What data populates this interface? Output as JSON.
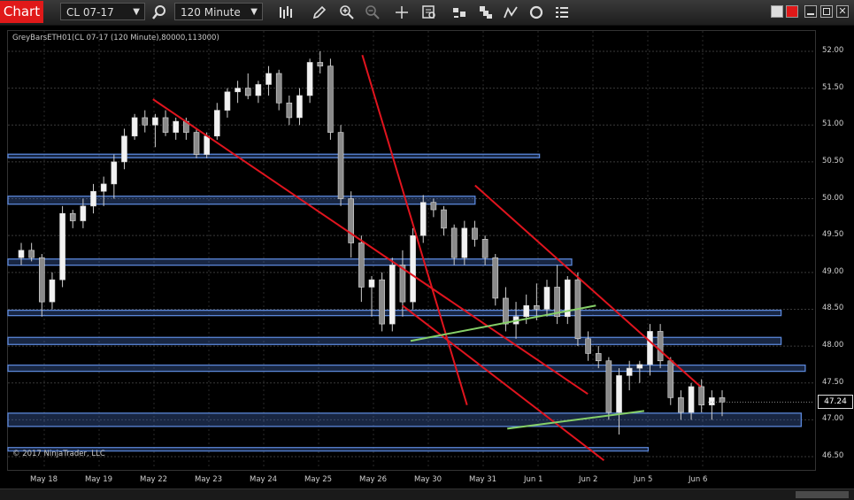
{
  "toolbar": {
    "chart_tab": "Chart",
    "instrument": "CL 07-17",
    "interval": "120 Minute",
    "icons": [
      "search-icon",
      "bars-icon",
      "pencil-icon",
      "zoom-in-icon",
      "zoom-out-icon",
      "crosshair-icon",
      "data-box-icon",
      "performance-icon",
      "strategy-icon",
      "drawing-tools-icon",
      "reload-icon",
      "properties-icon"
    ]
  },
  "window_controls": [
    "white-square",
    "red-square",
    "minimize",
    "maximize",
    "close"
  ],
  "chart": {
    "title": "GreyBarsETH01(CL 07-17 (120 Minute),80000,113000)",
    "copyright": "© 2017 NinjaTrader, LLC",
    "last_price": "47.24",
    "y_ticks": [
      "52.00",
      "51.50",
      "51.00",
      "50.50",
      "50.00",
      "49.50",
      "49.00",
      "48.50",
      "48.00",
      "47.50",
      "47.00",
      "46.50"
    ],
    "x_ticks": [
      "May 18",
      "May 19",
      "May 22",
      "May 23",
      "May 24",
      "May 25",
      "May 26",
      "May 30",
      "May 31",
      "Jun 1",
      "Jun 2",
      "Jun 5",
      "Jun 6"
    ]
  },
  "chart_data": {
    "type": "candlestick",
    "instrument": "CL 07-17",
    "interval": "120 Minute",
    "ylim": [
      46.4,
      52.05
    ],
    "ohlc": [
      [
        49.2,
        49.4,
        49.1,
        49.3
      ],
      [
        49.3,
        49.4,
        49.15,
        49.2
      ],
      [
        49.2,
        49.25,
        48.4,
        48.6
      ],
      [
        48.6,
        49.0,
        48.5,
        48.9
      ],
      [
        48.9,
        49.9,
        48.8,
        49.8
      ],
      [
        49.8,
        49.85,
        49.6,
        49.7
      ],
      [
        49.7,
        50.0,
        49.6,
        49.9
      ],
      [
        49.9,
        50.2,
        49.8,
        50.1
      ],
      [
        50.1,
        50.3,
        49.9,
        50.2
      ],
      [
        50.2,
        50.6,
        50.0,
        50.5
      ],
      [
        50.5,
        50.95,
        50.4,
        50.85
      ],
      [
        50.85,
        51.15,
        50.8,
        51.1
      ],
      [
        51.1,
        51.2,
        50.9,
        51.0
      ],
      [
        51.0,
        51.15,
        50.7,
        51.1
      ],
      [
        51.1,
        51.2,
        50.85,
        50.9
      ],
      [
        50.9,
        51.1,
        50.8,
        51.05
      ],
      [
        51.05,
        51.1,
        50.8,
        50.9
      ],
      [
        50.9,
        50.95,
        50.55,
        50.6
      ],
      [
        50.6,
        50.9,
        50.55,
        50.85
      ],
      [
        50.85,
        51.3,
        50.8,
        51.2
      ],
      [
        51.2,
        51.5,
        51.1,
        51.45
      ],
      [
        51.45,
        51.6,
        51.3,
        51.5
      ],
      [
        51.5,
        51.7,
        51.35,
        51.4
      ],
      [
        51.4,
        51.6,
        51.3,
        51.55
      ],
      [
        51.55,
        51.8,
        51.4,
        51.7
      ],
      [
        51.7,
        51.75,
        51.2,
        51.3
      ],
      [
        51.3,
        51.4,
        51.0,
        51.1
      ],
      [
        51.1,
        51.5,
        51.0,
        51.4
      ],
      [
        51.4,
        51.9,
        51.3,
        51.85
      ],
      [
        51.85,
        52.0,
        51.7,
        51.8
      ],
      [
        51.8,
        51.9,
        50.8,
        50.9
      ],
      [
        50.9,
        51.0,
        49.9,
        50.0
      ],
      [
        50.0,
        50.1,
        49.2,
        49.4
      ],
      [
        49.4,
        49.5,
        48.6,
        48.8
      ],
      [
        48.8,
        48.95,
        48.4,
        48.9
      ],
      [
        48.9,
        49.0,
        48.2,
        48.3
      ],
      [
        48.3,
        49.2,
        48.2,
        49.1
      ],
      [
        49.1,
        49.3,
        48.4,
        48.6
      ],
      [
        48.6,
        49.6,
        48.5,
        49.5
      ],
      [
        49.5,
        50.05,
        49.4,
        49.95
      ],
      [
        49.95,
        50.0,
        49.75,
        49.85
      ],
      [
        49.85,
        49.9,
        49.5,
        49.6
      ],
      [
        49.6,
        49.65,
        49.1,
        49.2
      ],
      [
        49.2,
        49.7,
        49.1,
        49.6
      ],
      [
        49.6,
        49.7,
        49.35,
        49.45
      ],
      [
        49.45,
        49.5,
        49.1,
        49.2
      ],
      [
        49.2,
        49.25,
        48.55,
        48.65
      ],
      [
        48.65,
        48.8,
        48.2,
        48.3
      ],
      [
        48.3,
        48.6,
        48.1,
        48.4
      ],
      [
        48.4,
        48.7,
        48.3,
        48.55
      ],
      [
        48.55,
        48.85,
        48.35,
        48.5
      ],
      [
        48.5,
        48.9,
        48.4,
        48.8
      ],
      [
        48.8,
        49.1,
        48.3,
        48.4
      ],
      [
        48.4,
        48.95,
        48.3,
        48.9
      ],
      [
        48.9,
        49.0,
        48.0,
        48.1
      ],
      [
        48.1,
        48.2,
        47.8,
        47.9
      ],
      [
        47.9,
        48.0,
        47.7,
        47.8
      ],
      [
        47.8,
        47.85,
        47.0,
        47.1
      ],
      [
        47.1,
        47.7,
        46.8,
        47.6
      ],
      [
        47.6,
        47.8,
        47.4,
        47.7
      ],
      [
        47.7,
        47.8,
        47.5,
        47.75
      ],
      [
        47.75,
        48.3,
        47.6,
        48.2
      ],
      [
        48.2,
        48.3,
        47.7,
        47.8
      ],
      [
        47.8,
        47.85,
        47.2,
        47.3
      ],
      [
        47.3,
        47.4,
        47.0,
        47.1
      ],
      [
        47.1,
        47.5,
        47.0,
        47.45
      ],
      [
        47.45,
        47.55,
        47.1,
        47.2
      ],
      [
        47.2,
        47.4,
        47.0,
        47.3
      ],
      [
        47.3,
        47.4,
        47.05,
        47.24
      ]
    ],
    "horizontal_zones": [
      50.58,
      49.98,
      49.14,
      48.45,
      48.07,
      47.7,
      47.0
    ],
    "trend_lines": [
      {
        "color": "#e0141e",
        "from": [
          51.35,
          0.3
        ],
        "to": [
          47.35,
          0.84
        ]
      },
      {
        "color": "#e0141e",
        "from": [
          51.95,
          0.56
        ],
        "to": [
          47.2,
          0.69
        ]
      },
      {
        "color": "#e0141e",
        "from": [
          50.18,
          0.7
        ],
        "to": [
          47.45,
          0.98
        ]
      },
      {
        "color": "#e0141e",
        "from": [
          48.55,
          0.61
        ],
        "to": [
          46.45,
          0.86
        ]
      },
      {
        "color": "#86d068",
        "from": [
          48.07,
          0.62
        ],
        "to": [
          48.55,
          0.85
        ]
      },
      {
        "color": "#86d068",
        "from": [
          46.88,
          0.74
        ],
        "to": [
          47.12,
          0.91
        ]
      }
    ]
  }
}
